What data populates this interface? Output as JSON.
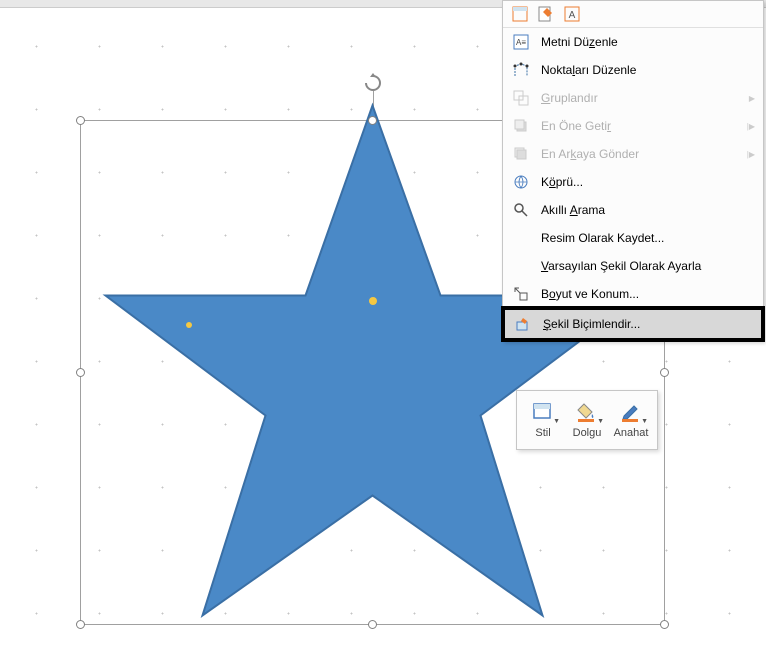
{
  "colors": {
    "star_fill": "#4a89c7",
    "star_stroke": "#3a6fa5",
    "accent_orange": "#ed7d31"
  },
  "menu": {
    "edit_text": "Metni Düzenle",
    "edit_points": "Noktaları Düzenle",
    "group": "Gruplandır",
    "bring_front": "En Öne Getir",
    "send_back": "En Arkaya Gönder",
    "hyperlink": "Köprü...",
    "smart_lookup": "Akıllı Arama",
    "save_as_picture": "Resim Olarak Kaydet...",
    "set_default_shape": "Varsayılan Şekil Olarak Ayarla",
    "size_position": "Boyut ve Konum...",
    "format_shape": "Şekil Biçimlendir..."
  },
  "floating": {
    "style": "Stil",
    "fill": "Dolgu",
    "outline": "Anahat"
  }
}
